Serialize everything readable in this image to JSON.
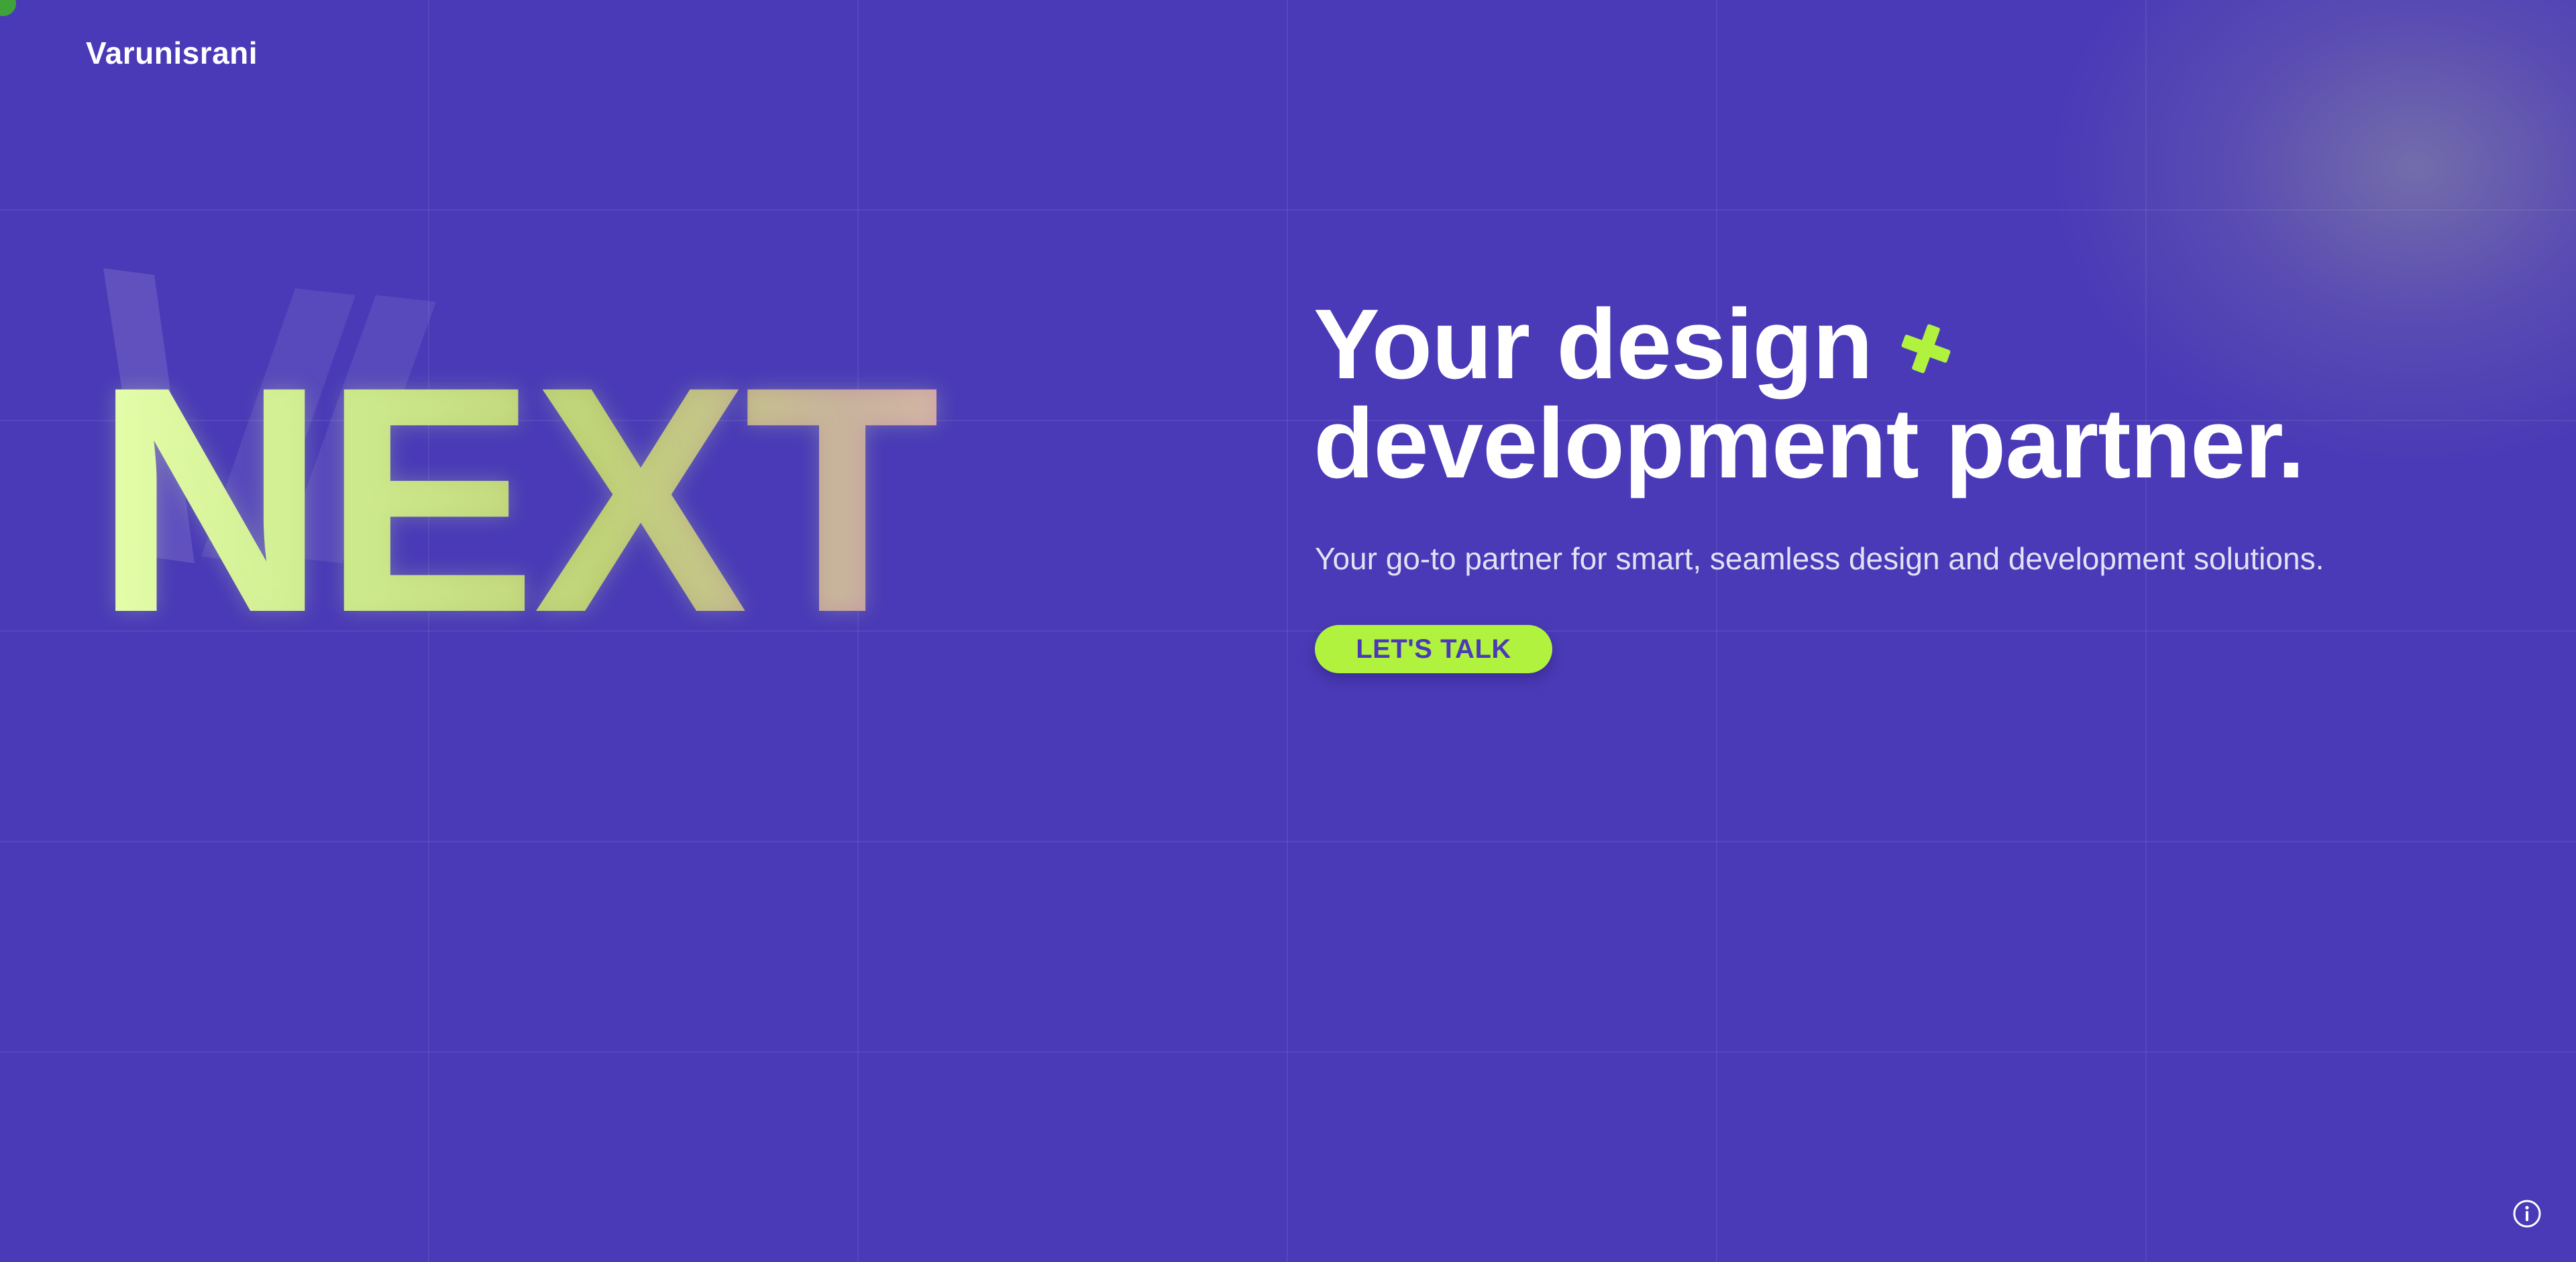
{
  "brand": {
    "name": "Varunisrani"
  },
  "hero": {
    "big_word": "NEXT",
    "headline_line1": "Your design",
    "headline_line2": "development partner.",
    "subtitle": "Your go-to partner for smart, seamless design and development solutions.",
    "cta_label": "LET'S TALK"
  },
  "icons": {
    "plus": "plus-icon",
    "info": "info-icon"
  },
  "colors": {
    "background": "#4a3ab7",
    "accent": "#b1f23f",
    "text": "#ffffff"
  }
}
